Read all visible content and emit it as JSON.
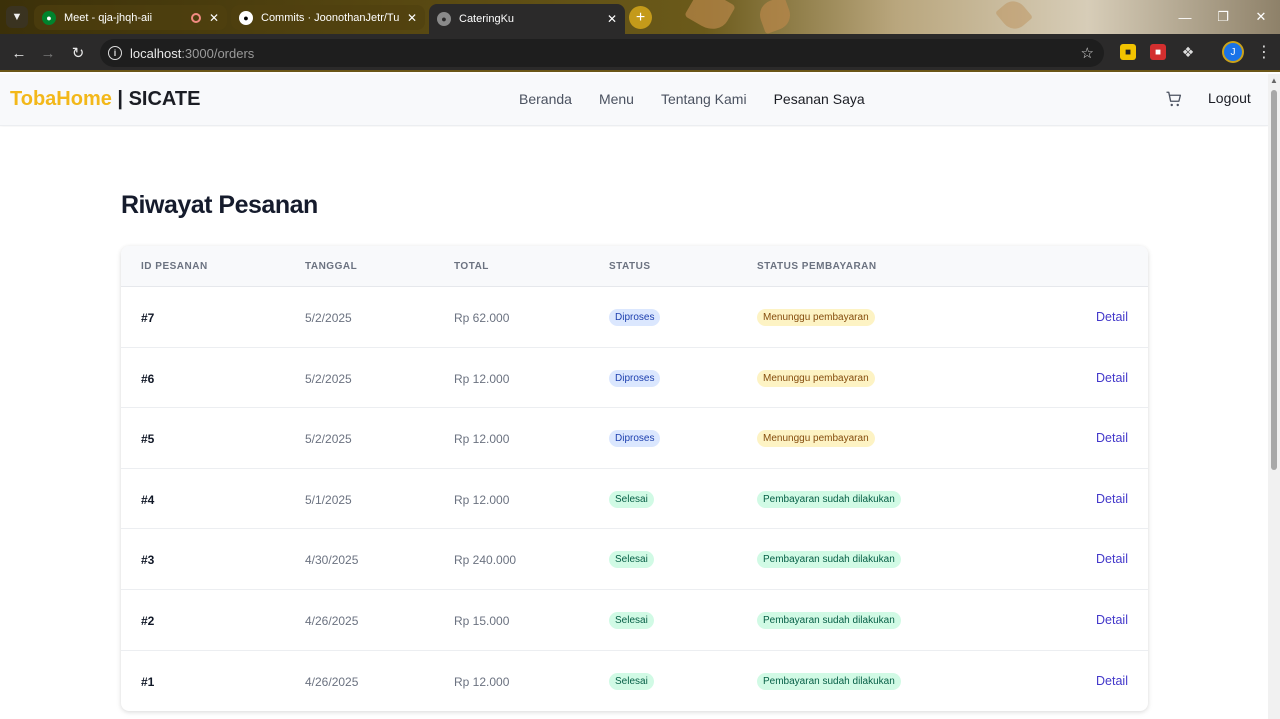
{
  "browser": {
    "tabs": [
      {
        "title": "Meet - qja-jhqh-aii",
        "icon": "google-meet-icon"
      },
      {
        "title": "Commits · JoonothanJetr/Tubes",
        "icon": "github-icon"
      },
      {
        "title": "CateringKu",
        "icon": "globe-icon"
      }
    ],
    "url_host": "localhost",
    "url_path": ":3000/orders",
    "profile_initial": "J"
  },
  "nav": {
    "brand_primary": "TobaHome",
    "brand_secondary": " | SICATE",
    "links": [
      "Beranda",
      "Menu",
      "Tentang Kami",
      "Pesanan Saya"
    ],
    "logout": "Logout"
  },
  "page": {
    "title": "Riwayat Pesanan",
    "columns": [
      "ID PESANAN",
      "TANGGAL",
      "TOTAL",
      "STATUS",
      "STATUS PEMBAYARAN"
    ],
    "detail_label": "Detail",
    "orders": [
      {
        "id": "#7",
        "date": "5/2/2025",
        "total": "Rp 62.000",
        "status": "Diproses",
        "payment": "Menunggu pembayaran"
      },
      {
        "id": "#6",
        "date": "5/2/2025",
        "total": "Rp 12.000",
        "status": "Diproses",
        "payment": "Menunggu pembayaran"
      },
      {
        "id": "#5",
        "date": "5/2/2025",
        "total": "Rp 12.000",
        "status": "Diproses",
        "payment": "Menunggu pembayaran"
      },
      {
        "id": "#4",
        "date": "5/1/2025",
        "total": "Rp 12.000",
        "status": "Selesai",
        "payment": "Pembayaran sudah dilakukan"
      },
      {
        "id": "#3",
        "date": "4/30/2025",
        "total": "Rp 240.000",
        "status": "Selesai",
        "payment": "Pembayaran sudah dilakukan"
      },
      {
        "id": "#2",
        "date": "4/26/2025",
        "total": "Rp 15.000",
        "status": "Selesai",
        "payment": "Pembayaran sudah dilakukan"
      },
      {
        "id": "#1",
        "date": "4/26/2025",
        "total": "Rp 12.000",
        "status": "Selesai",
        "payment": "Pembayaran sudah dilakukan"
      }
    ]
  },
  "colors": {
    "brand_yellow": "#f3b81a",
    "detail_link": "#4338ca",
    "status_processing": "#dbe7fe",
    "status_done": "#d1fae5",
    "payment_waiting": "#fdf3c4"
  }
}
